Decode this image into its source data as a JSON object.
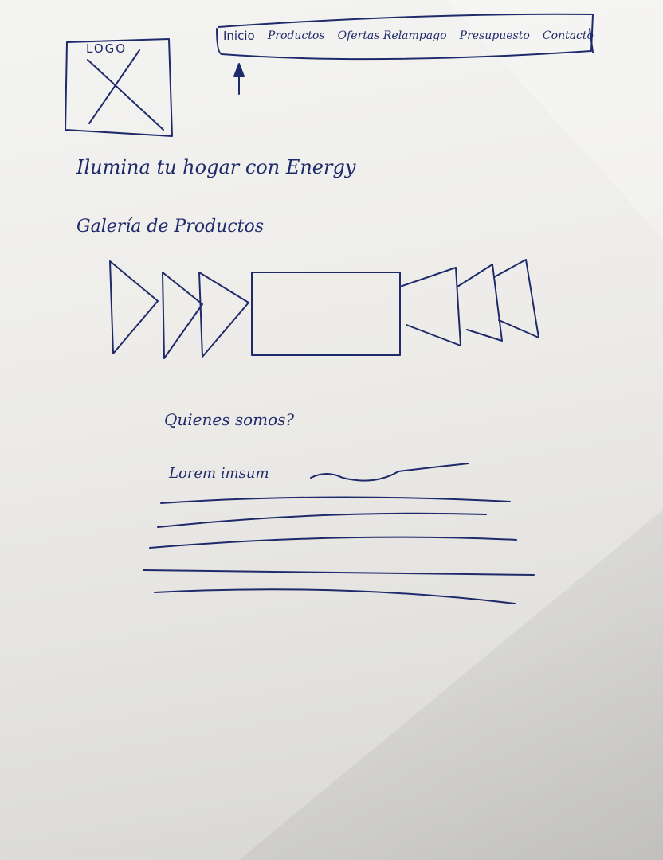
{
  "header": {
    "logo_label": "LOGO",
    "nav": [
      "Inicio",
      "Productos",
      "Ofertas Relampago",
      "Presupuesto",
      "Contacto"
    ]
  },
  "hero": {
    "title": "Ilumina tu hogar con Energy"
  },
  "gallery": {
    "title": "Galería de Productos"
  },
  "about": {
    "title": "Quienes somos?",
    "text": "Lorem imsum"
  },
  "colors": {
    "ink": "#1f2a6b",
    "paper": "#efeeeb"
  }
}
